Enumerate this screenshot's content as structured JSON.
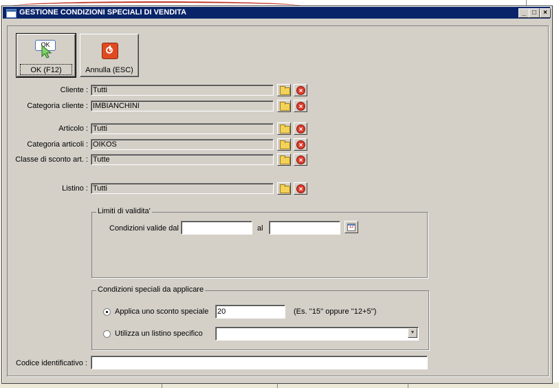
{
  "window": {
    "title": "GESTIONE CONDIZIONI SPECIALI DI VENDITA",
    "minimize": "_",
    "maximize": "□",
    "close": "×"
  },
  "toolbar": {
    "ok_icon_text": "OK",
    "ok_label": "OK (F12)",
    "cancel_label": "Annulla (ESC)"
  },
  "fields": {
    "cliente": {
      "label": "Cliente :",
      "value": "Tutti"
    },
    "categoria_cliente": {
      "label": "Categoria cliente :",
      "value": "IMBIANCHINI"
    },
    "articolo": {
      "label": "Articolo :",
      "value": "Tutti"
    },
    "categoria_articoli": {
      "label": "Categoria articoli :",
      "value": "OIKOS"
    },
    "classe_sconto": {
      "label": "Classe di sconto art. :",
      "value": "Tutte"
    },
    "listino": {
      "label": "Listino :",
      "value": "Tutti"
    }
  },
  "validita": {
    "legend": "Limiti di validita'",
    "dal_label": "Condizioni valide dal",
    "dal_value": "",
    "al_label": "al",
    "al_value": "",
    "calendar_icon_text": "12"
  },
  "condizioni": {
    "legend": "Condizioni speciali da applicare",
    "option1_label": "Applica uno sconto speciale",
    "option1_selected": true,
    "sconto_value": "20",
    "hint": "(Es. ''15'' oppure ''12+5'')",
    "option2_label": "Utilizza un listino specifico",
    "option2_selected": false,
    "listino_value": ""
  },
  "codice": {
    "label": "Codice identificativo :",
    "value": ""
  },
  "colors": {
    "titlebar": "#0a246a",
    "face": "#d4d0c8",
    "delete_icon": "#d93c2c",
    "folder_icon": "#f3d25a"
  }
}
